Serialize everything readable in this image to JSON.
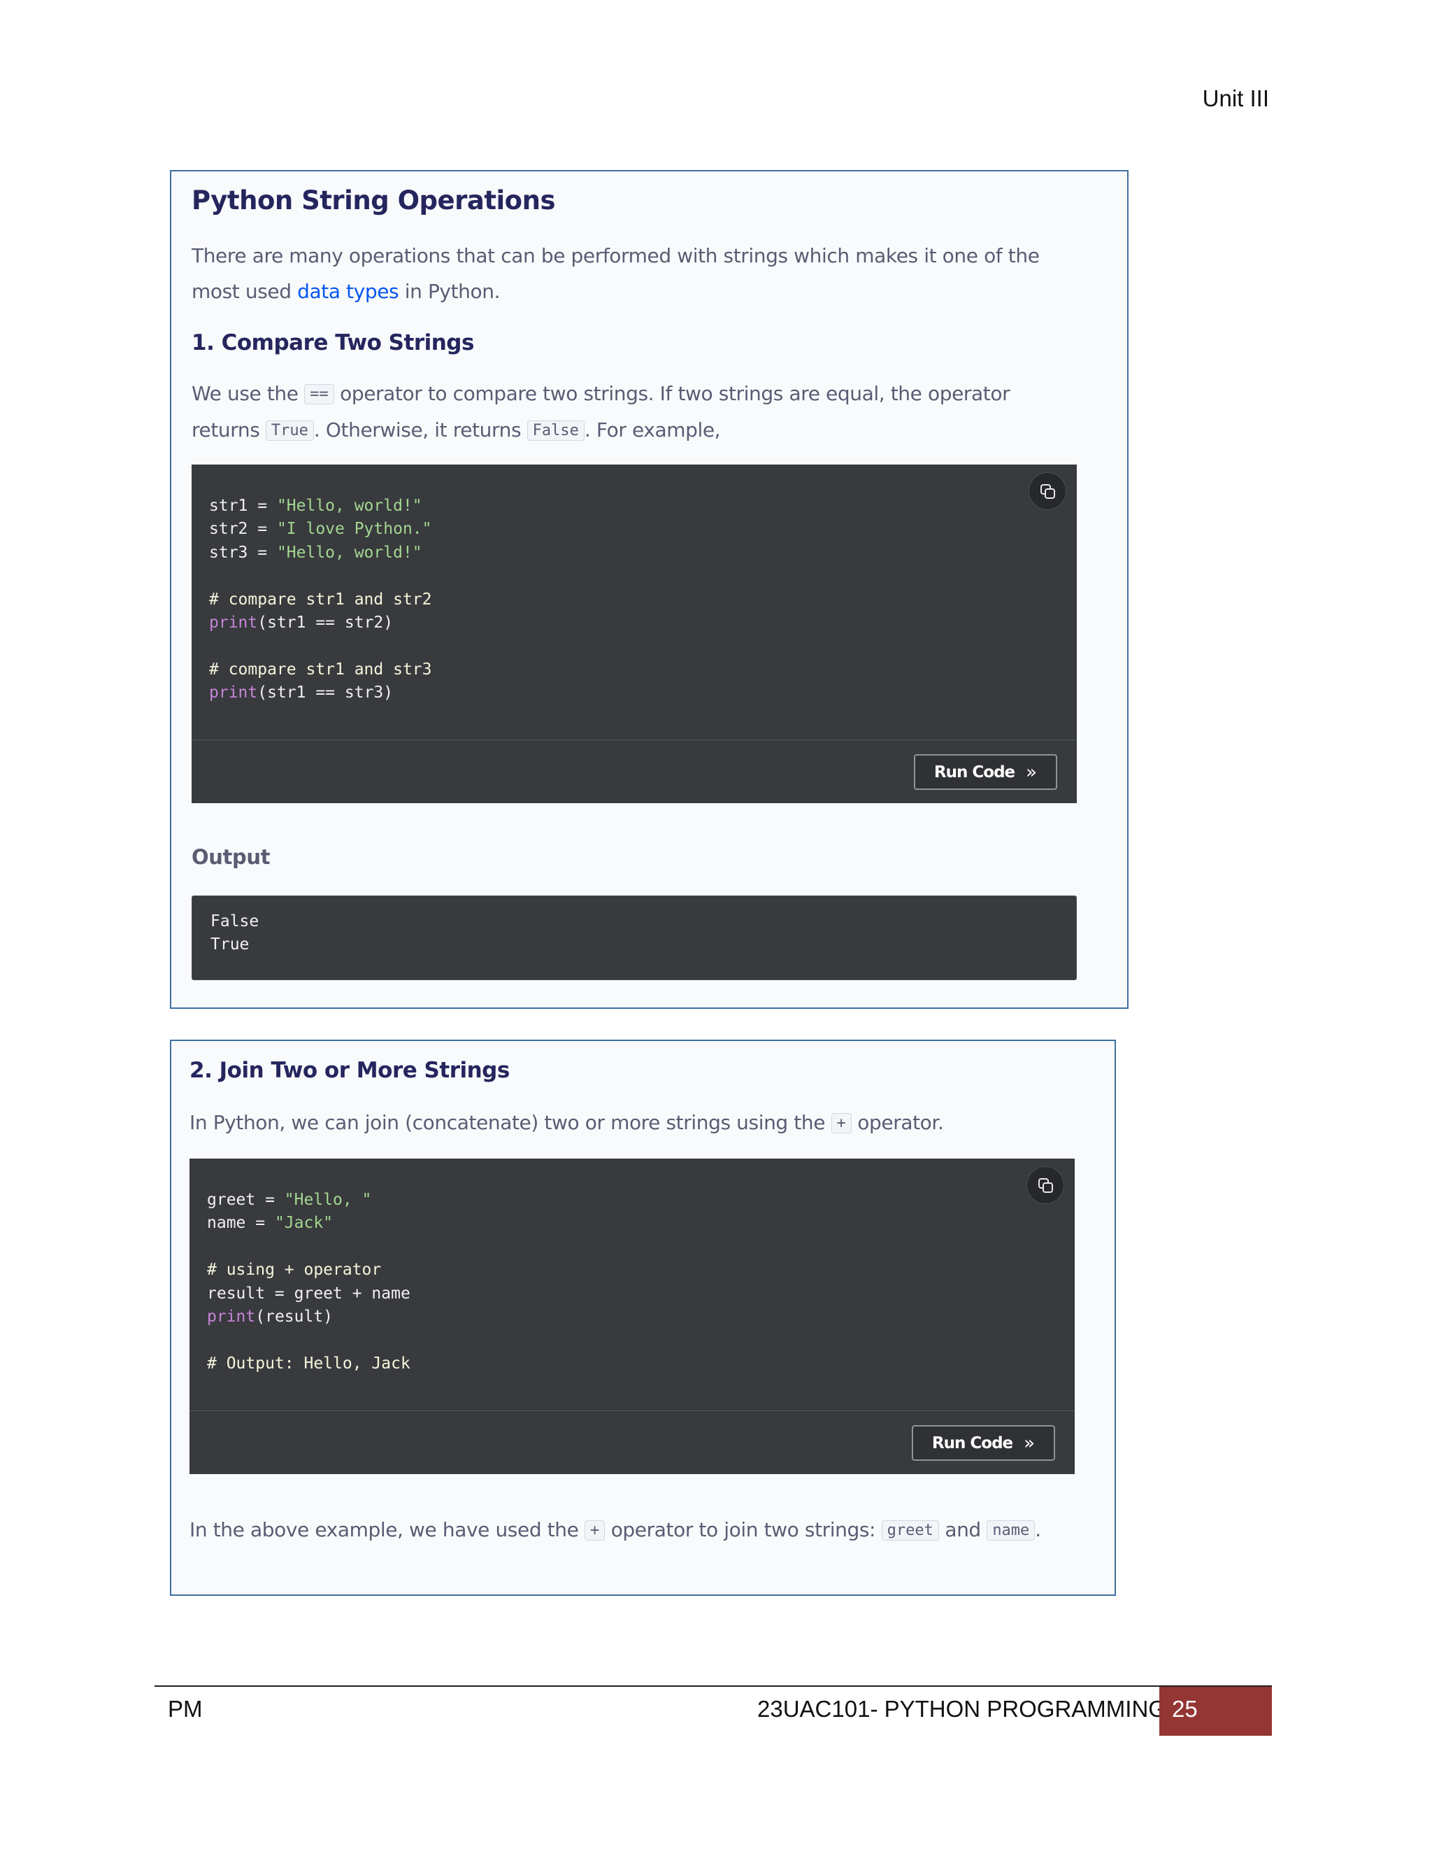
{
  "header": {
    "unit": "Unit III"
  },
  "section1": {
    "title": "Python String Operations",
    "intro_a": "There are many operations that can be performed with strings which makes it one of the",
    "intro_b": "most used ",
    "intro_link": "data types",
    "intro_c": " in Python.",
    "subtitle": "1. Compare Two Strings",
    "desc_a": "We use the ",
    "desc_code1": "==",
    "desc_b": " operator to compare two strings. If two strings are equal, the operator",
    "desc_c": "returns ",
    "desc_code2": "True",
    "desc_d": ". Otherwise, it returns ",
    "desc_code3": "False",
    "desc_e": ". For example,",
    "code": {
      "l1_a": "str1 = ",
      "l1_s": "\"Hello, world!\"",
      "l2_a": "str2 = ",
      "l2_s": "\"I love Python.\"",
      "l3_a": "str3 = ",
      "l3_s": "\"Hello, world!\"",
      "l4": "# compare str1 and str2",
      "l5_f": "print",
      "l5_r": "(str1 == str2)",
      "l6": "# compare str1 and str3",
      "l7_f": "print",
      "l7_r": "(str1 == str3)"
    },
    "run_label": "Run Code",
    "output_label": "Output",
    "output": {
      "l1": "False",
      "l2": "True"
    }
  },
  "section2": {
    "title": "2. Join Two or More Strings",
    "desc_a": "In Python, we can join (concatenate) two or more strings using the ",
    "desc_code": "+",
    "desc_b": " operator.",
    "code": {
      "l1_a": "greet = ",
      "l1_s": "\"Hello, \"",
      "l2_a": "name = ",
      "l2_s": "\"Jack\"",
      "l3": "# using + operator",
      "l4": "result = greet + name",
      "l5_f": "print",
      "l5_r": "(result)",
      "l6": "# Output: Hello, Jack"
    },
    "run_label": "Run Code",
    "after_a": "In the above example, we have used the ",
    "after_code1": "+",
    "after_b": " operator to join two strings: ",
    "after_code2": "greet",
    "after_c": " and ",
    "after_code3": "name",
    "after_d": "."
  },
  "footer": {
    "left": "PM",
    "course": "23UAC101- PYTHON PROGRAMMING",
    "page": "25",
    "page_box_color": "#943634"
  },
  "icons": {
    "copy": "copy-icon",
    "run_chevron": "double-chevron-right-icon"
  },
  "colors": {
    "card_border": "#3e6fa3",
    "title": "#25265e",
    "link": "#0556f3",
    "code_bg": "#383a3d",
    "string": "#a3d690",
    "function": "#c684d8"
  }
}
